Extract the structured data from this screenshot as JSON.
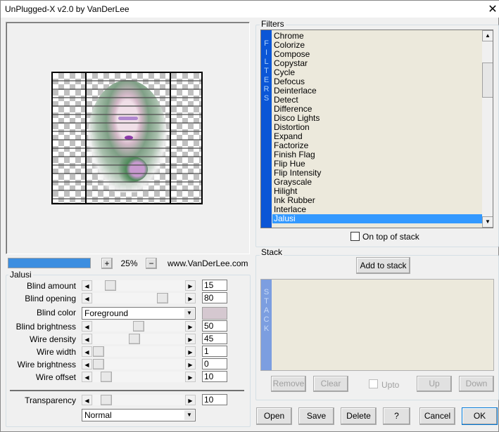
{
  "window": {
    "title": "UnPlugged-X v2.0 by VanDerLee",
    "close_icon": "close-icon"
  },
  "preview": {
    "progress_percent": 100,
    "zoom_in_label": "+",
    "zoom_value": "25%",
    "zoom_out_label": "−",
    "url": "www.VanDerLee.com"
  },
  "params": {
    "group_label": "Jalusi",
    "sliders": [
      {
        "label": "Blind amount",
        "value": "15",
        "fraction": 0.15
      },
      {
        "label": "Blind opening",
        "value": "80",
        "fraction": 0.8
      },
      {
        "label": "Blind brightness",
        "value": "50",
        "fraction": 0.5
      },
      {
        "label": "Wire density",
        "value": "45",
        "fraction": 0.45
      },
      {
        "label": "Wire width",
        "value": "1",
        "fraction": 0.0
      },
      {
        "label": "Wire brightness",
        "value": "0",
        "fraction": 0.0
      },
      {
        "label": "Wire offset",
        "value": "10",
        "fraction": 0.1
      }
    ],
    "blind_color": {
      "label": "Blind color",
      "selected": "Foreground",
      "swatch": "#d5c8d0"
    },
    "transparency": {
      "label": "Transparency",
      "value": "10",
      "fraction": 0.1
    },
    "blend_mode": "Normal"
  },
  "filters": {
    "group_label": "Filters",
    "strip_text": "FILTERS",
    "items": [
      "Chrome",
      "Colorize",
      "Compose",
      "Copystar",
      "Cycle",
      "Defocus",
      "Deinterlace",
      "Detect",
      "Difference",
      "Disco Lights",
      "Distortion",
      "Expand",
      "Factorize",
      "Finish Flag",
      "Flip Hue",
      "Flip Intensity",
      "Grayscale",
      "Hilight",
      "Ink Rubber",
      "Interlace",
      "Jalusi"
    ],
    "selected": "Jalusi",
    "on_top_label": "On top of stack",
    "on_top_checked": false,
    "accent": "#3399ff"
  },
  "stack": {
    "group_label": "Stack",
    "add_label": "Add to stack",
    "strip_text": "STACK",
    "remove_label": "Remove",
    "clear_label": "Clear",
    "upto_label": "Upto",
    "up_label": "Up",
    "down_label": "Down"
  },
  "footer": {
    "open": "Open",
    "save": "Save",
    "delete": "Delete",
    "help": "?",
    "cancel": "Cancel",
    "ok": "OK"
  }
}
